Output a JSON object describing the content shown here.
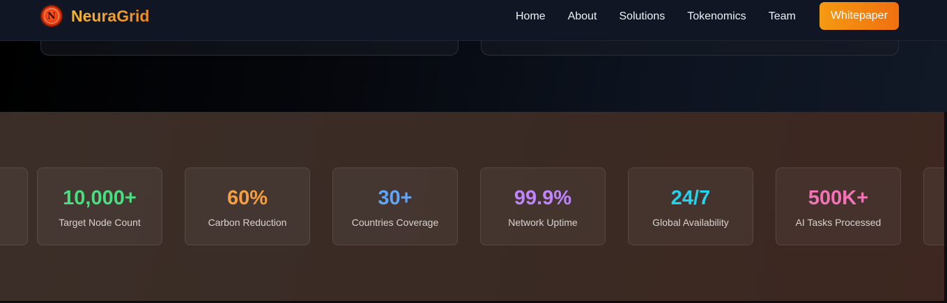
{
  "nav": {
    "brand": "NeuraGrid",
    "logo_letter": "N",
    "links": [
      "Home",
      "About",
      "Solutions",
      "Tokenomics",
      "Team"
    ],
    "cta": "Whitepaper"
  },
  "stats": [
    {
      "value": "10,000+",
      "label": "Target Node Count",
      "color": "#4ade80"
    },
    {
      "value": "60%",
      "label": "Carbon Reduction",
      "color": "#f59e42"
    },
    {
      "value": "30+",
      "label": "Countries Coverage",
      "color": "#60a5fa"
    },
    {
      "value": "99.9%",
      "label": "Network Uptime",
      "color": "#c084fc"
    },
    {
      "value": "24/7",
      "label": "Global Availability",
      "color": "#22d3ee"
    },
    {
      "value": "500K+",
      "label": "AI Tasks Processed",
      "color": "#f472b6"
    }
  ],
  "colors": {
    "accent": "#f5a623",
    "cta_start": "#f59a12",
    "cta_end": "#f0700f"
  }
}
